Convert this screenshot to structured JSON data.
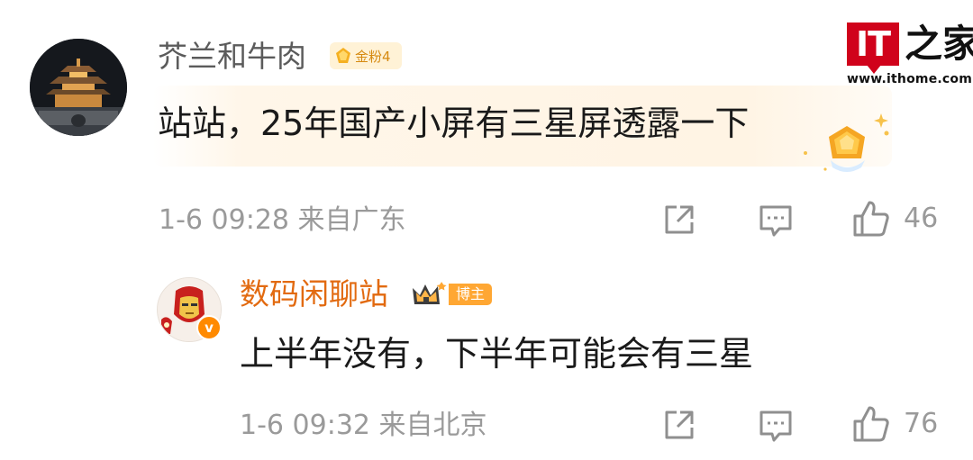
{
  "watermark": {
    "logo_text": "IT",
    "logo_glyph": "之家",
    "url": "www.ithome.com"
  },
  "comments": [
    {
      "username": "芥兰和牛肉",
      "badge": "金粉4",
      "text": "站站，25年国产小屏有三星屏透露一下",
      "timestamp": "1-6 09:28",
      "location": "来自广东",
      "likes": "46",
      "icons": [
        "share-icon",
        "comment-icon",
        "like-icon"
      ]
    },
    {
      "username": "数码闲聊站",
      "badge": "博主",
      "text": "上半年没有，下半年可能会有三星",
      "timestamp": "1-6 09:32",
      "location": "来自北京",
      "likes": "76",
      "icons": [
        "share-icon",
        "comment-icon",
        "like-icon"
      ]
    }
  ],
  "colors": {
    "author_name": "#e26a10",
    "fan_badge_bg": "#fff2d6",
    "fan_badge_text": "#d68a11",
    "blogger_badge": "#ffa733",
    "meta_text": "#9a9a9a",
    "logo_red": "#d0021b"
  }
}
